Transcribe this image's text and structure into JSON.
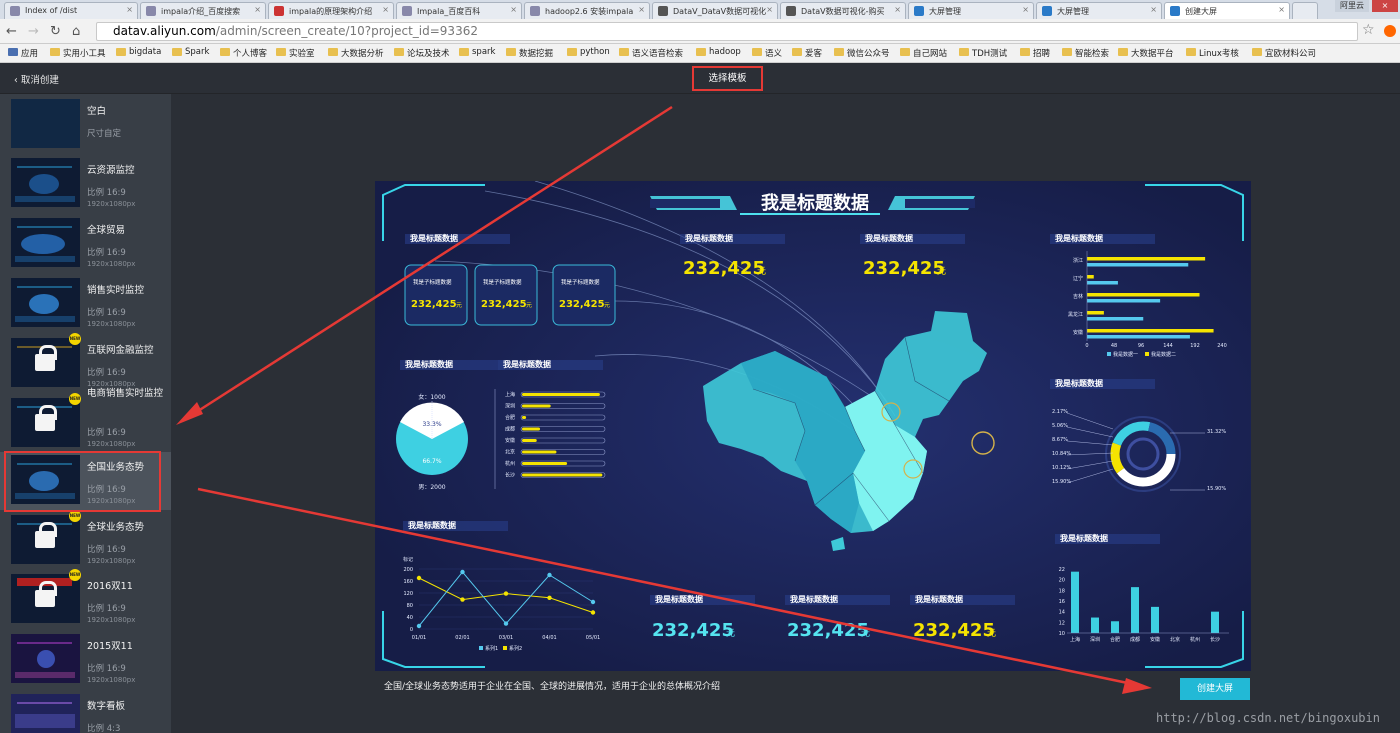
{
  "browser": {
    "tabs": [
      {
        "title": "Index of /dist"
      },
      {
        "title": "impala介绍_百度搜索"
      },
      {
        "title": "impala的原理架构介绍"
      },
      {
        "title": "Impala_百度百科"
      },
      {
        "title": "hadoop2.6 安装impala"
      },
      {
        "title": "DataV_DataV数据可视化"
      },
      {
        "title": "DataV数据可视化-购买"
      },
      {
        "title": "大屏管理"
      },
      {
        "title": "大屏管理"
      },
      {
        "title": "创建大屏"
      }
    ],
    "user_badge": "阿里云",
    "url_domain": "datav.aliyun.com",
    "url_path": "/admin/screen_create/10?project_id=93362",
    "bookmarks": [
      "应用",
      "实用小工具",
      "bigdata",
      "Spark",
      "个人博客",
      "实验室",
      "大数据分析",
      "论坛及技术",
      "spark",
      "数据挖掘",
      "python",
      "语义语音检索",
      "hadoop",
      "语义",
      "爱客",
      "微信公众号",
      "自己网站",
      "TDH测试",
      "招聘",
      "智能检索",
      "大数据平台",
      "Linux考核",
      "宜欧材料公司"
    ]
  },
  "header": {
    "back_label": "取消创建",
    "title": "选择模板"
  },
  "templates": [
    {
      "name": "空白",
      "ratio": "尺寸自定",
      "size": ""
    },
    {
      "name": "云资源监控",
      "ratio": "比例 16:9",
      "size": "1920x1080px"
    },
    {
      "name": "全球贸易",
      "ratio": "比例 16:9",
      "size": "1920x1080px"
    },
    {
      "name": "销售实时监控",
      "ratio": "比例 16:9",
      "size": "1920x1080px"
    },
    {
      "name": "互联网金融监控",
      "ratio": "比例 16:9",
      "size": "1920x1080px"
    },
    {
      "name": "电商销售实时监控",
      "ratio": "比例 16:9",
      "size": "1920x1080px"
    },
    {
      "name": "全国业务态势",
      "ratio": "比例 16:9",
      "size": "1920x1080px"
    },
    {
      "name": "全球业务态势",
      "ratio": "比例 16:9",
      "size": "1920x1080px"
    },
    {
      "name": "2016双11",
      "ratio": "比例 16:9",
      "size": "1920x1080px"
    },
    {
      "name": "2015双11",
      "ratio": "比例 16:9",
      "size": "1920x1080px"
    },
    {
      "name": "数字看板",
      "ratio": "比例 4:3",
      "size": "1024x768px"
    }
  ],
  "new_badge": "NEW",
  "preview": {
    "title": "我是标题数据",
    "panel_title": "我是标题数据",
    "sub_title": "我是子标题数据",
    "big_number": "232,425",
    "unit": "元",
    "pie": {
      "female_label": "女：1000",
      "male_label": "男：2000",
      "pct_a": "33.3%",
      "pct_b": "66.7%"
    },
    "bar_cities": [
      "上海",
      "深圳",
      "合肥",
      "成都",
      "安徽",
      "北京",
      "杭州",
      "长沙"
    ],
    "bar_fills": [
      0.95,
      0.35,
      0.05,
      0.22,
      0.18,
      0.42,
      0.55,
      0.98
    ],
    "hbar": {
      "provinces": [
        "浙江",
        "辽宁",
        "吉林",
        "黑龙江",
        "安徽"
      ],
      "series1": [
        210,
        12,
        200,
        30,
        225
      ],
      "series2": [
        180,
        55,
        130,
        100,
        183
      ],
      "ticks": [
        "0",
        "48",
        "96",
        "144",
        "192",
        "240"
      ],
      "legend": [
        "我是数据一",
        "我是数据二"
      ],
      "max": 240
    },
    "donut": {
      "left_labels": [
        "2.17%",
        "5.06%",
        "8.67%",
        "10.84%",
        "10.12%",
        "15.90%"
      ],
      "right_labels": [
        "31.32%",
        "15.90%"
      ]
    },
    "line": {
      "ylabel": "标记",
      "yticks": [
        "200",
        "160",
        "120",
        "80",
        "40",
        "0"
      ],
      "xticks": [
        "01/01",
        "02/01",
        "03/01",
        "04/01",
        "05/01"
      ],
      "series1": [
        170,
        98,
        118,
        104,
        55
      ],
      "series2": [
        10,
        190,
        18,
        180,
        90
      ],
      "legend": [
        "系列1",
        "系列2"
      ],
      "max": 200
    },
    "vbar": {
      "categories": [
        "上海",
        "深圳",
        "合肥",
        "成都",
        "安徽",
        "北京",
        "杭州",
        "长沙"
      ],
      "values": [
        21.5,
        12.9,
        12.2,
        18.6,
        14.9,
        9.8,
        10,
        14
      ],
      "yticks": [
        "22",
        "20",
        "18",
        "16",
        "14",
        "12",
        "10"
      ],
      "min": 10,
      "max": 22
    },
    "description": "全国/全球业务态势适用于企业在全国、全球的进展情况，适用于企业的总体概况介绍"
  },
  "create_button": "创建大屏",
  "watermark": "http://blog.csdn.net/bingoxubin",
  "colors": {
    "accent": "#22b9d6",
    "highlight": "#e53935",
    "yellow": "#f5e400",
    "cyan": "#55e4f0",
    "panel_bg": "#19214f"
  }
}
